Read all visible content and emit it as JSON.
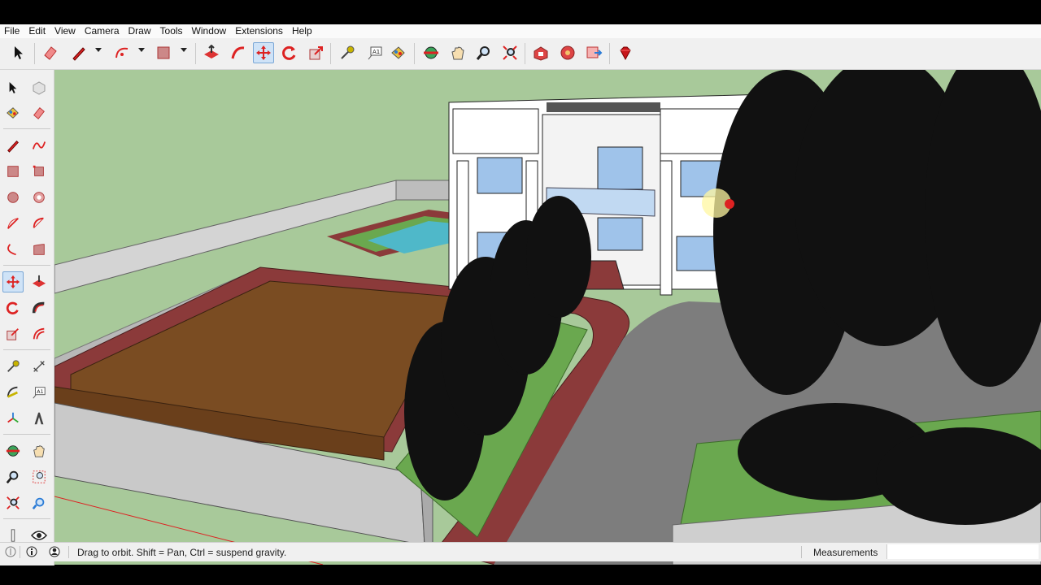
{
  "menu": [
    "File",
    "Edit",
    "View",
    "Camera",
    "Draw",
    "Tools",
    "Window",
    "Extensions",
    "Help"
  ],
  "toolbar": {
    "icons": [
      "select-icon",
      "eraser-icon",
      "pencil-line-icon",
      "arc-icon",
      "rectangle-icon",
      "push-pull-icon",
      "follow-me-icon",
      "move-icon",
      "rotate-icon",
      "scale-icon",
      "tape-measure-icon",
      "text-icon",
      "paint-bucket-icon",
      "orbit-icon",
      "pan-icon",
      "zoom-icon",
      "zoom-extents-icon",
      "3d-warehouse-icon",
      "extension-warehouse-icon",
      "layout-icon",
      "ruby-icon"
    ],
    "active": "move-icon"
  },
  "left_toolbar": {
    "icons": [
      "select-icon",
      "component-icon",
      "paint-bucket-icon",
      "eraser-icon",
      "line-icon",
      "freehand-icon",
      "rectangle-icon",
      "rotated-rectangle-icon",
      "circle-icon",
      "polygon-icon",
      "arc-icon",
      "pie-icon",
      "two-point-arc-icon",
      "three-point-arc-icon",
      "move-icon",
      "push-pull-icon",
      "rotate-icon",
      "follow-me-icon",
      "scale-icon",
      "offset-icon",
      "tape-measure-icon",
      "dimension-icon",
      "protractor-icon",
      "text-icon",
      "axes-icon",
      "3d-text-icon",
      "orbit-icon",
      "pan-icon",
      "zoom-icon",
      "zoom-window-icon",
      "zoom-extents-icon",
      "previous-view-icon",
      "walk-icon",
      "look-around-icon"
    ],
    "active": "move-icon"
  },
  "status": {
    "hint": "Drag to orbit. Shift = Pan, Ctrl = suspend gravity.",
    "measurements_label": "Measurements",
    "measurements_value": ""
  },
  "colors": {
    "sky": "#a5c796",
    "deck": "#7a4c22",
    "path": "#8b3a3a",
    "grass": "#6aa84f",
    "pool": "#4fb8c9",
    "wall": "#c9c9c9",
    "accent": "#cfe3f7"
  }
}
